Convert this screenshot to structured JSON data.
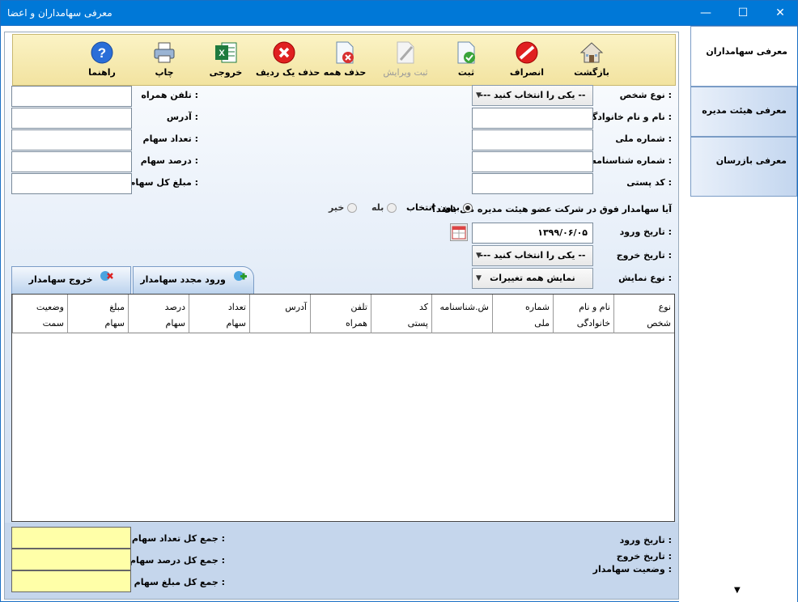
{
  "window": {
    "title": "معرفی سهامداران و اعضا",
    "min": "—",
    "max": "☐",
    "close": "✕"
  },
  "toolbar": {
    "back": "بازگشت",
    "cancel": "انصراف",
    "save": "ثبت",
    "save_edit": "ثبت ویرایش",
    "delete_all": "حذف همه",
    "delete_row": "حذف یک ردیف",
    "export": "خروجی",
    "print": "چاپ",
    "help": "راهنما"
  },
  "form": {
    "person_type_label": "نوع شخص :",
    "person_type_value": "--- یکی را انتخاب کنید --",
    "name_label": "نام و نام خانوادگی :",
    "national_id_label": "شماره ملی :",
    "id_card_label": "شماره شناسنامه :",
    "postal_label": "کد پستی :",
    "mobile_label": "تلفن همراه :",
    "address_label": "آدرس :",
    "share_count_label": "تعداد سهام :",
    "share_percent_label": "درصد سهام :",
    "share_total_label": "مبلغ کل سهام :",
    "board_question": "آیا سهامدار فوق در شرکت عضو هیئت مدیره می باشد؟",
    "radio_none": "بدون انتخاب",
    "radio_yes": "بله",
    "radio_no": "خیر",
    "entry_date_label": "تاریخ ورود :",
    "entry_date_value": "۱۳۹۹/۰۶/۰۵",
    "exit_date_label": "تاریخ خروج :",
    "exit_date_value": "--- یکی را انتخاب کنید --",
    "view_type_label": "نوع نمایش :",
    "view_type_value": "نمایش همه تغییرات"
  },
  "tabs": {
    "reentry": "ورود مجدد سهامدار",
    "exit": "خروج سهامدار"
  },
  "grid": {
    "columns": [
      "نوع\nشخص",
      "نام و نام\nخانوادگی",
      "شماره\nملی",
      "ش.شناسنامه",
      "کد\nپستی",
      "تلفن\nهمراه",
      "آدرس",
      "تعداد\nسهام",
      "درصد\nسهام",
      "مبلغ\nسهام",
      "وضعیت\nسمت"
    ]
  },
  "footer": {
    "entry_date": "تاریخ ورود :",
    "exit_date": "تاریخ خروج :",
    "status": "وضعیت سهامدار :",
    "sum_count": "جمع کل تعداد سهام :",
    "sum_percent": "جمع کل درصد سهام :",
    "sum_amount": "جمع کل مبلغ سهام :"
  },
  "sidebar": {
    "items": [
      "معرفی سهامداران",
      "معرفی هیئت مدیره",
      "معرفی بازرسان"
    ]
  },
  "colors": {
    "titlebar": "#0078d7",
    "toolbar": "#f5e9b0",
    "sum_fields": "#ffffa8"
  }
}
